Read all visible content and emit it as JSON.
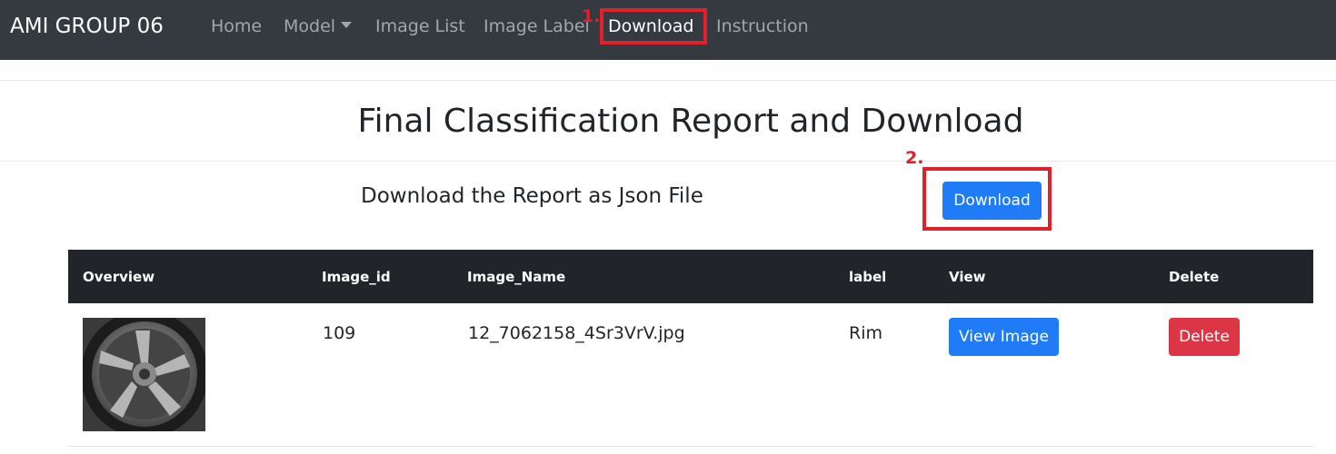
{
  "navbar": {
    "brand": "AMI GROUP 06",
    "links": {
      "home": "Home",
      "model": "Model",
      "image_list": "Image List",
      "image_label": "Image Label",
      "download": "Download",
      "instruction": "Instruction"
    },
    "active": "download"
  },
  "callouts": {
    "step1": "1.",
    "step2": "2."
  },
  "page": {
    "title": "Final Classification Report and Download",
    "subtitle": "Download the Report as Json File",
    "download_button": "Download"
  },
  "table": {
    "headers": [
      "Overview",
      "Image_id",
      "Image_Name",
      "label",
      "View",
      "Delete"
    ],
    "rows": [
      {
        "overview": "wheel-rim-thumbnail",
        "image_id": "109",
        "image_name": "12_7062158_4Sr3VrV.jpg",
        "label": "Rim",
        "view_label": "View Image",
        "delete_label": "Delete"
      }
    ]
  },
  "colors": {
    "navbar_bg": "#343a40",
    "primary": "#1f7cf6",
    "danger": "#dc3545",
    "callout": "#e0202b",
    "table_head": "#212529"
  }
}
